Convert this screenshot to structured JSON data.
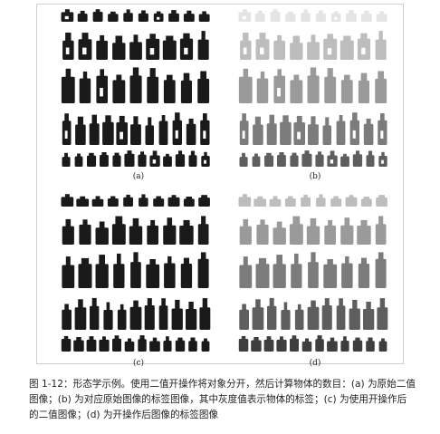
{
  "figure": {
    "panels": [
      {
        "id": "a",
        "label": "(a)",
        "variant": "binary"
      },
      {
        "id": "b",
        "label": "(b)",
        "variant": "labeled"
      },
      {
        "id": "c",
        "label": "(c)",
        "variant": "binary"
      },
      {
        "id": "d",
        "label": "(d)",
        "variant": "labeled"
      }
    ],
    "colors": {
      "binary_fill": "#1a1a1a",
      "label_row_fills": [
        "#e4e4e4",
        "#bdbdbd",
        "#9a9a9a",
        "#7c7c7c",
        "#5e5e5e",
        "#3e3e3e"
      ]
    }
  },
  "caption": {
    "line1": "图 1-12：形态学示例。使用二值开操作将对象分开，然后计算物体的数目：(a) 为原始二值",
    "line2": "图像；(b) 为对应原始图像的标签图像，其中灰度值表示物体的标签；(c) 为使用开操作后",
    "line3": "的二值图像；(d) 为开操作后图像的标签图像"
  }
}
